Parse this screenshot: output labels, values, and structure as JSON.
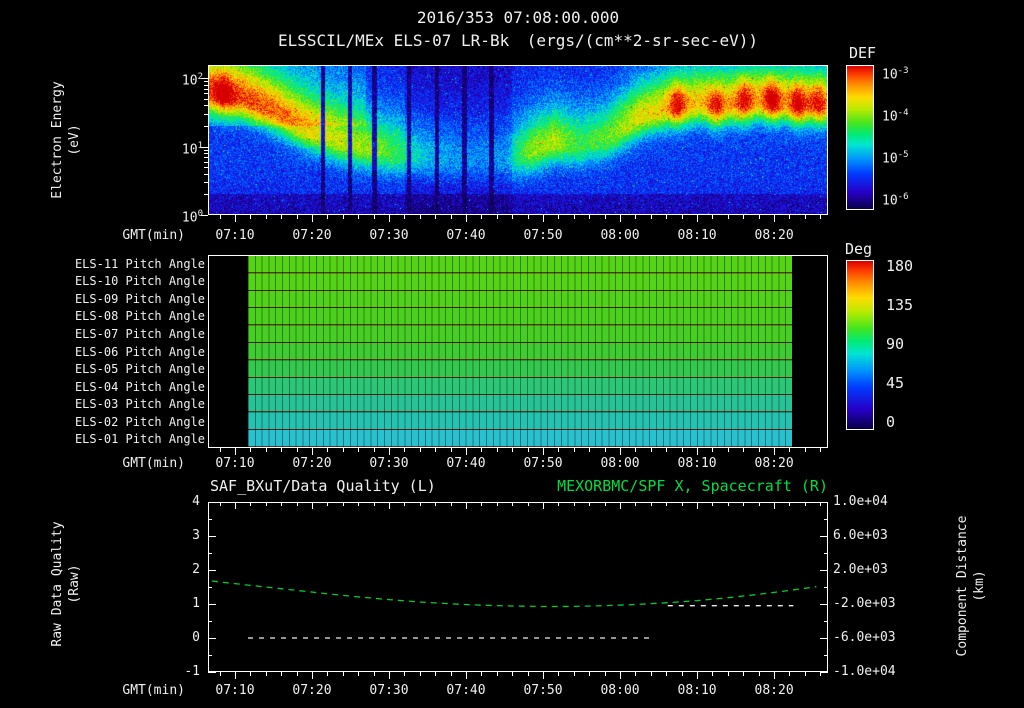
{
  "header": {
    "datetime": "2016/353 07:08:00.000"
  },
  "time_axis": {
    "label": "GMT(min)",
    "start_min": 426.5,
    "end_min": 507.0,
    "minor_step_min": 2,
    "major_ticks": [
      {
        "t": 430,
        "label": "07:10"
      },
      {
        "t": 440,
        "label": "07:20"
      },
      {
        "t": 450,
        "label": "07:30"
      },
      {
        "t": 460,
        "label": "07:40"
      },
      {
        "t": 470,
        "label": "07:50"
      },
      {
        "t": 480,
        "label": "08:00"
      },
      {
        "t": 490,
        "label": "08:10"
      },
      {
        "t": 500,
        "label": "08:20"
      }
    ]
  },
  "chart_data": [
    {
      "id": "electron-energy-spectrogram",
      "type": "heatmap",
      "title": "ELSSCIL/MEx ELS-07 LR-Bk",
      "units": "(ergs/(cm**2-sr-sec-eV))",
      "xlabel": "GMT(min)",
      "ylabel_lines": [
        "Electron Energy",
        "(eV)"
      ],
      "y_scale": "log",
      "y_range_ev": [
        1,
        155
      ],
      "y_ticks": [
        {
          "base": "10",
          "exp": "2",
          "logv": 2
        },
        {
          "base": "10",
          "exp": "1",
          "logv": 1
        },
        {
          "base": "10",
          "exp": "0",
          "logv": 0
        }
      ],
      "colorbar": {
        "label": "DEF",
        "scale": "log",
        "ticks": [
          {
            "base": "10",
            "exp": "-3"
          },
          {
            "base": "10",
            "exp": "-4"
          },
          {
            "base": "10",
            "exp": "-5"
          },
          {
            "base": "10",
            "exp": "-6"
          }
        ]
      },
      "features": {
        "description": "Electron flux band ~60 eV (yellow-orange) at 07:09 descending to ~6 eV by 07:40, weak 07:35-07:48, brief 8-12 eV enhancement near 07:50, rising to 30-50 eV after 07:55 with orange-red bursts 08:05-08:25; blue noisy background with narrow black dropouts.",
        "band_t_ev_strength": [
          [
            427,
            60,
            0.62
          ],
          [
            431,
            50,
            0.6
          ],
          [
            435,
            32,
            0.55
          ],
          [
            439,
            18,
            0.5
          ],
          [
            443,
            12,
            0.44
          ],
          [
            447,
            9,
            0.4
          ],
          [
            451,
            7.5,
            0.3
          ],
          [
            455,
            6.5,
            0.2
          ],
          [
            460,
            6,
            0.14
          ],
          [
            465,
            6,
            0.15
          ],
          [
            468.5,
            8,
            0.38
          ],
          [
            471.5,
            11,
            0.42
          ],
          [
            475,
            10,
            0.3
          ],
          [
            478.5,
            13,
            0.35
          ],
          [
            482.5,
            26,
            0.48
          ],
          [
            486.5,
            36,
            0.52
          ],
          [
            490.5,
            42,
            0.54
          ],
          [
            494.5,
            40,
            0.55
          ],
          [
            498.5,
            46,
            0.55
          ],
          [
            502.5,
            42,
            0.56
          ],
          [
            507,
            40,
            0.54
          ]
        ],
        "hot_spots_t_logev_strength": [
          [
            428.5,
            1.78,
            0.18
          ],
          [
            487.5,
            1.62,
            0.26
          ],
          [
            492.5,
            1.55,
            0.22
          ],
          [
            496.2,
            1.7,
            0.24
          ],
          [
            499.8,
            1.68,
            0.3
          ],
          [
            503.2,
            1.6,
            0.27
          ],
          [
            505.8,
            1.64,
            0.22
          ]
        ],
        "dropout_times": [
          441.4,
          444.9,
          448.1,
          452.6,
          456.2,
          459.8,
          463.3
        ],
        "quiet_interval": [
          452,
          466
        ]
      }
    },
    {
      "id": "pitch-angle-panels",
      "type": "heatmap",
      "xlabel": "GMT(min)",
      "data_time_range": [
        "07:12",
        "08:22"
      ],
      "colorbar": {
        "label": "Deg",
        "ticks": [
          "180",
          "135",
          "90",
          "45",
          "0"
        ],
        "range": [
          0,
          180
        ]
      },
      "rows": [
        {
          "label": "ELS-11 Pitch Angle",
          "pitch_deg": 105,
          "color": "#55d316"
        },
        {
          "label": "ELS-10 Pitch Angle",
          "pitch_deg": 105,
          "color": "#55d316"
        },
        {
          "label": "ELS-09 Pitch Angle",
          "pitch_deg": 104,
          "color": "#50d11a"
        },
        {
          "label": "ELS-08 Pitch Angle",
          "pitch_deg": 103,
          "color": "#4cd01e"
        },
        {
          "label": "ELS-07 Pitch Angle",
          "pitch_deg": 102,
          "color": "#47ce24"
        },
        {
          "label": "ELS-06 Pitch Angle",
          "pitch_deg": 100,
          "color": "#3fcb32"
        },
        {
          "label": "ELS-05 Pitch Angle",
          "pitch_deg": 97,
          "color": "#35c84e"
        },
        {
          "label": "ELS-04 Pitch Angle",
          "pitch_deg": 93,
          "color": "#2cc676"
        },
        {
          "label": "ELS-03 Pitch Angle",
          "pitch_deg": 88,
          "color": "#27c396"
        },
        {
          "label": "ELS-02 Pitch Angle",
          "pitch_deg": 83,
          "color": "#26c2b0"
        },
        {
          "label": "ELS-01 Pitch Angle",
          "pitch_deg": 76,
          "color": "#2ac0cd"
        }
      ]
    },
    {
      "id": "quality-and-distance",
      "type": "line",
      "title_left": "SAF_BXuT/Data Quality (L)",
      "title_right": "MEXORBMC/SPF X, Spacecraft (R)",
      "title_right_color": "#00dd44",
      "xlabel": "GMT(min)",
      "ylabel_left_lines": [
        "Raw Data Quality",
        "(Raw)"
      ],
      "ylabel_right_lines": [
        "Component Distance",
        "(km)"
      ],
      "y_left": {
        "range": [
          -1,
          4
        ],
        "ticks": [
          "4",
          "3",
          "2",
          "1",
          "0",
          "-1"
        ],
        "minor_step": 0.5
      },
      "y_right": {
        "range": [
          -10000,
          10000
        ],
        "tick_labels": [
          "1.0e+04",
          "6.0e+03",
          "2.0e+03",
          "-2.0e+03",
          "-6.0e+03",
          "-1.0e+04"
        ]
      },
      "series": [
        {
          "name": "MEXORBMC/SPF X Spacecraft",
          "axis": "right",
          "color": "#00cc33",
          "line_style": "dashed",
          "points_t_km": [
            [
              427,
              700
            ],
            [
              431,
              300
            ],
            [
              434,
              0
            ],
            [
              438,
              -400
            ],
            [
              442,
              -800
            ],
            [
              446,
              -1160
            ],
            [
              450,
              -1480
            ],
            [
              454,
              -1760
            ],
            [
              458,
              -1980
            ],
            [
              462,
              -2140
            ],
            [
              466,
              -2240
            ],
            [
              470,
              -2290
            ],
            [
              474,
              -2280
            ],
            [
              478,
              -2200
            ],
            [
              482,
              -2060
            ],
            [
              486,
              -1860
            ],
            [
              490,
              -1600
            ],
            [
              494,
              -1260
            ],
            [
              498,
              -860
            ],
            [
              502,
              -400
            ],
            [
              505.5,
              40
            ]
          ]
        },
        {
          "name": "SAF_BXuT Data Quality",
          "axis": "left",
          "color": "#eeeeee",
          "line_style": "dashed",
          "segments": [
            {
              "t_start": 431.7,
              "t_end": 484.5,
              "value": 0
            },
            {
              "t_start": 486.2,
              "t_end": 502.5,
              "value": 0.95
            }
          ]
        }
      ]
    }
  ]
}
